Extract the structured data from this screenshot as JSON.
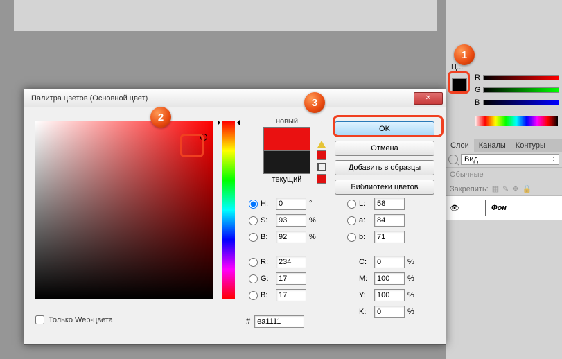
{
  "dialog": {
    "title": "Палитра цветов (Основной цвет)",
    "new_label": "новый",
    "current_label": "текущий",
    "ok": "OK",
    "cancel": "Отмена",
    "add_swatch": "Добавить в образцы",
    "libraries": "Библиотеки цветов",
    "web_only": "Только Web-цвета",
    "hex_prefix": "#",
    "hex": "ea1111",
    "fields": {
      "H": {
        "label": "H:",
        "value": "0",
        "unit": "°"
      },
      "S": {
        "label": "S:",
        "value": "93",
        "unit": "%"
      },
      "Bv": {
        "label": "B:",
        "value": "92",
        "unit": "%"
      },
      "R": {
        "label": "R:",
        "value": "234",
        "unit": ""
      },
      "G": {
        "label": "G:",
        "value": "17",
        "unit": ""
      },
      "B": {
        "label": "B:",
        "value": "17",
        "unit": ""
      },
      "L": {
        "label": "L:",
        "value": "58",
        "unit": ""
      },
      "a": {
        "label": "a:",
        "value": "84",
        "unit": ""
      },
      "b": {
        "label": "b:",
        "value": "71",
        "unit": ""
      },
      "C": {
        "label": "C:",
        "value": "0",
        "unit": "%"
      },
      "M": {
        "label": "M:",
        "value": "100",
        "unit": "%"
      },
      "Y": {
        "label": "Y:",
        "value": "100",
        "unit": "%"
      },
      "K": {
        "label": "K:",
        "value": "0",
        "unit": "%"
      }
    }
  },
  "side": {
    "color_tab": "Ц...",
    "rgb": {
      "R": "R",
      "G": "G",
      "B": "B"
    },
    "layers_tabs": {
      "layers": "Слои",
      "channels": "Каналы",
      "paths": "Контуры"
    },
    "filter_label": "Вид",
    "blend": "Обычные",
    "lock_label": "Закрепить:",
    "layer_name": "Фон"
  },
  "anno": {
    "n1": "1",
    "n2": "2",
    "n3": "3"
  }
}
